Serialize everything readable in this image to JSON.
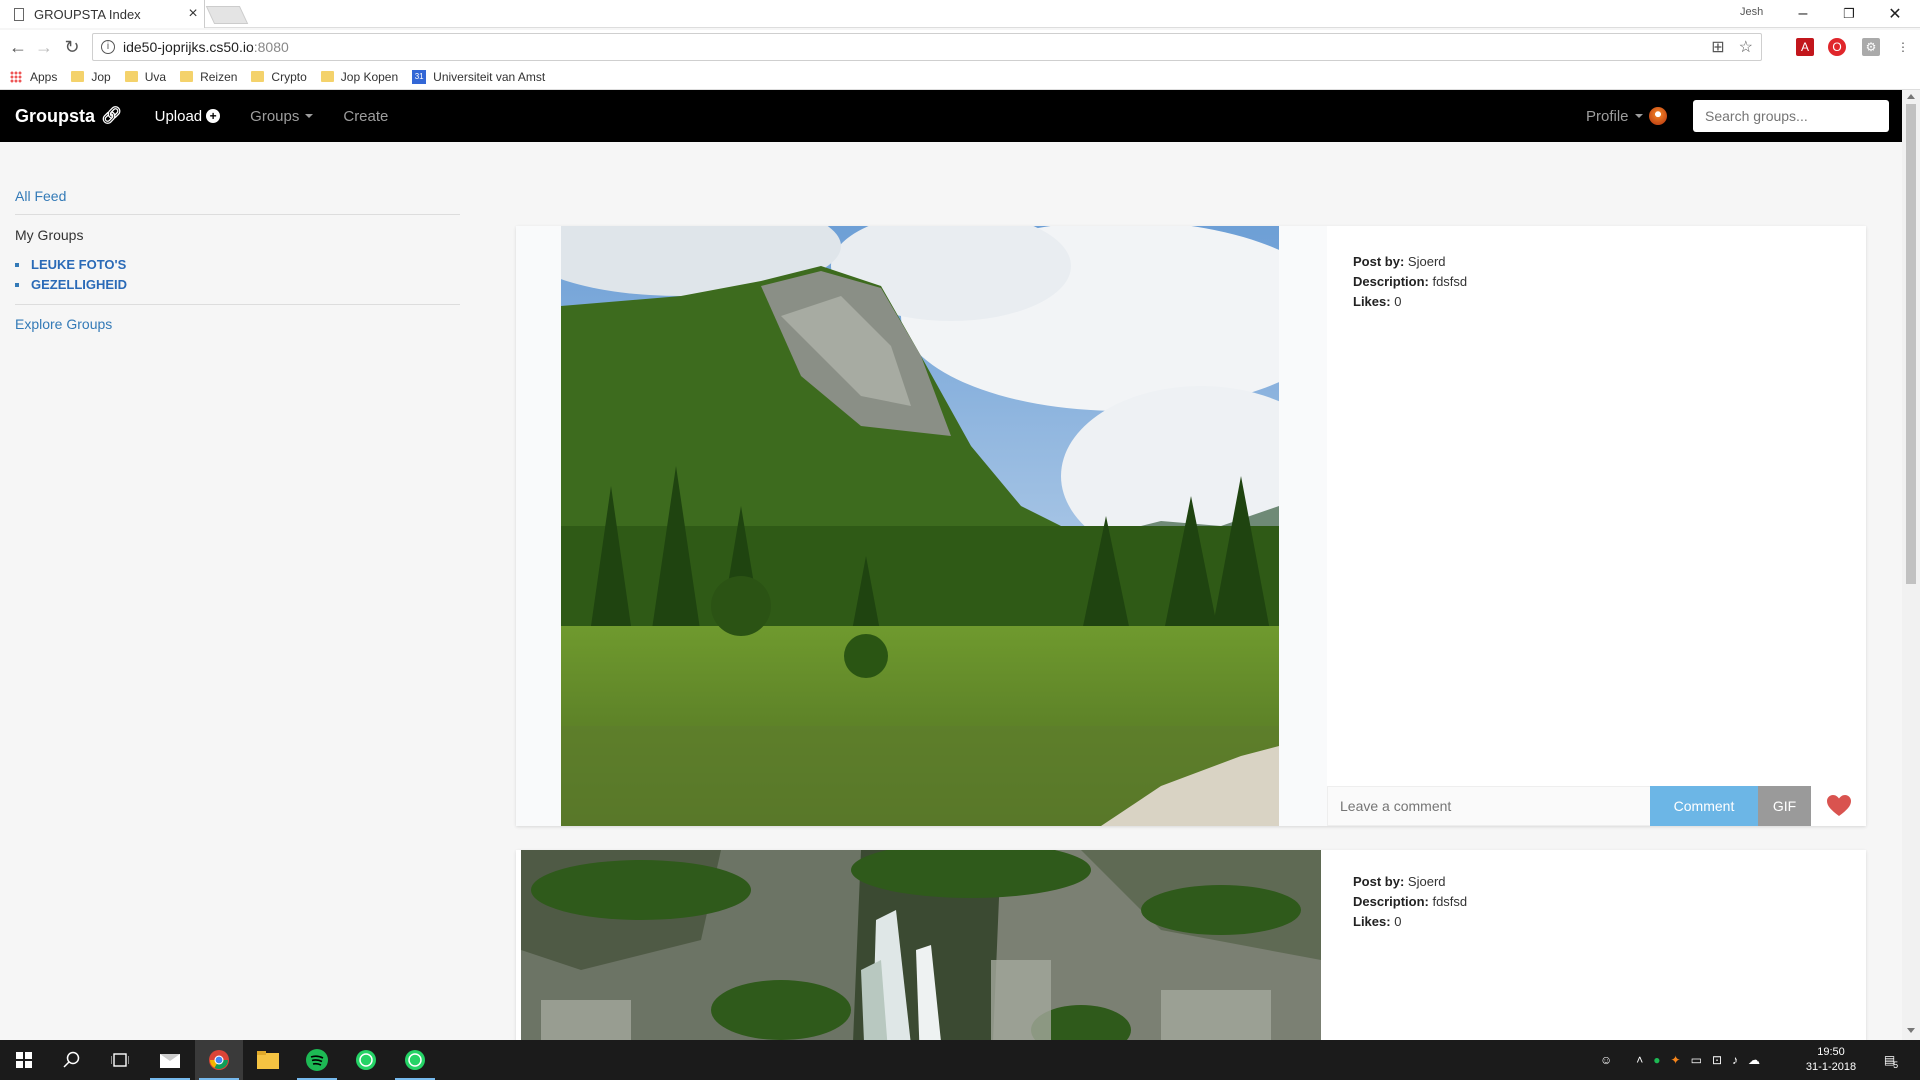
{
  "browser": {
    "tab_title": "GROUPSTA Index",
    "profile_name": "Jesh",
    "url_host": "ide50-joprijks.cs50.io",
    "url_port": ":8080",
    "bookmarks": [
      {
        "label": "Apps",
        "icon": "apps-grid-icon"
      },
      {
        "label": "Jop",
        "icon": "folder-icon"
      },
      {
        "label": "Uva",
        "icon": "folder-icon"
      },
      {
        "label": "Reizen",
        "icon": "folder-icon"
      },
      {
        "label": "Crypto",
        "icon": "folder-icon"
      },
      {
        "label": "Jop Kopen",
        "icon": "folder-icon"
      },
      {
        "label": "Universiteit van Amst",
        "icon": "calendar-icon",
        "icon_text": "31"
      }
    ]
  },
  "navbar": {
    "brand": "Groupsta",
    "upload": "Upload",
    "groups": "Groups",
    "create": "Create",
    "profile": "Profile",
    "search_placeholder": "Search groups..."
  },
  "sidebar": {
    "all_feed": "All Feed",
    "my_groups": "My Groups",
    "groups": [
      "LEUKE FOTO'S",
      "GEZELLIGHEID"
    ],
    "explore": "Explore Groups"
  },
  "posts": [
    {
      "post_by_label": "Post by:",
      "post_by": "Sjoerd",
      "description_label": "Description:",
      "description": "fdsfsd",
      "likes_label": "Likes:",
      "likes": "0",
      "comment_placeholder": "Leave a comment",
      "comment_button": "Comment",
      "gif_button": "GIF",
      "photo": "mountain-meadow-photo"
    },
    {
      "post_by_label": "Post by:",
      "post_by": "Sjoerd",
      "description_label": "Description:",
      "description": "fdsfsd",
      "likes_label": "Likes:",
      "likes": "0",
      "photo": "waterfall-gorge-photo"
    }
  ],
  "taskbar": {
    "time": "19:50",
    "date": "31-1-2018",
    "notifications": "5"
  },
  "colors": {
    "navbar_bg": "#000000",
    "link": "#337ab7",
    "comment_button": "#6cb6e6",
    "gif_button": "#9a9a9a",
    "heart": "#d9534f"
  }
}
